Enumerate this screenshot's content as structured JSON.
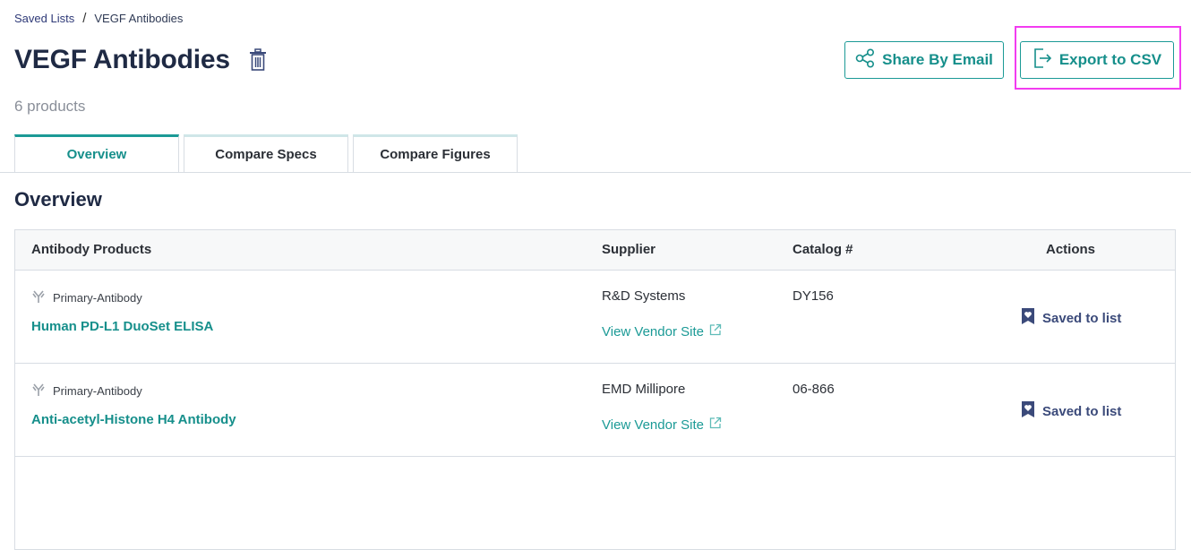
{
  "breadcrumb": {
    "parent": "Saved Lists",
    "separator": "/",
    "current": "VEGF Antibodies"
  },
  "page": {
    "title": "VEGF Antibodies",
    "count_label": "6 products"
  },
  "actions": {
    "share_label": "Share By Email",
    "export_label": "Export to CSV"
  },
  "tabs": [
    {
      "label": "Overview",
      "active": true
    },
    {
      "label": "Compare Specs",
      "active": false
    },
    {
      "label": "Compare Figures",
      "active": false
    }
  ],
  "section_title": "Overview",
  "table": {
    "headers": {
      "product": "Antibody Products",
      "supplier": "Supplier",
      "catalog": "Catalog #",
      "actions": "Actions"
    },
    "rows": [
      {
        "type": "Primary-Antibody",
        "name": "Human PD-L1 DuoSet ELISA",
        "supplier": "R&D Systems",
        "vendor_link": "View Vendor Site",
        "catalog": "DY156",
        "action": "Saved to list"
      },
      {
        "type": "Primary-Antibody",
        "name": "Anti-acetyl-Histone H4 Antibody",
        "supplier": "EMD Millipore",
        "vendor_link": "View Vendor Site",
        "catalog": "06-866",
        "action": "Saved to list"
      }
    ]
  },
  "colors": {
    "accent": "#1b9a96",
    "highlight": "#f23cf0",
    "text": "#1f2a44",
    "saved": "#3b4a7a"
  },
  "icons": [
    "trash-icon",
    "share-icon",
    "export-icon",
    "antibody-icon",
    "external-link-icon",
    "bookmark-heart-icon"
  ]
}
